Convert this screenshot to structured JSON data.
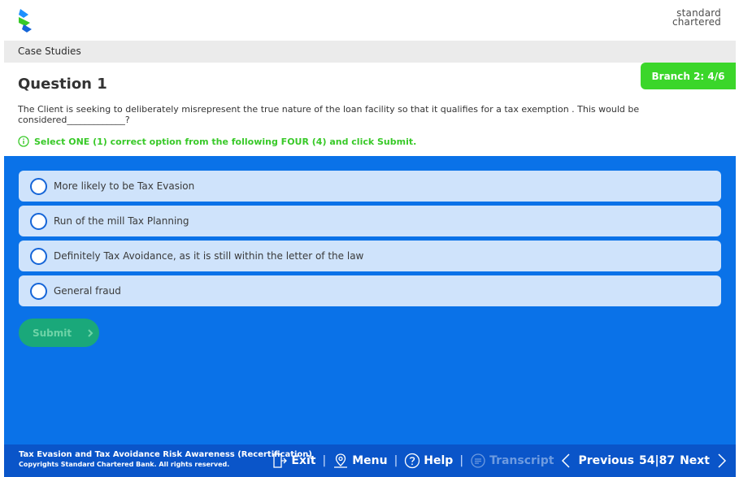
{
  "header": {
    "brand_line1": "standard",
    "brand_line2": "chartered"
  },
  "breadcrumb": "Case Studies",
  "branch_badge": "Branch 2: 4/6",
  "question": {
    "title": "Question 1",
    "text": "The Client is seeking to deliberately misrepresent the true nature of the loan facility so that it qualifies for a tax exemption . This would be considered_____________?",
    "instruction": "Select ONE (1) correct option from the following FOUR (4) and click Submit."
  },
  "options": [
    {
      "label": "More likely to be Tax Evasion",
      "selected": false
    },
    {
      "label": "Run of the mill Tax Planning",
      "selected": false
    },
    {
      "label": "Definitely Tax Avoidance, as it is still within the letter of the law",
      "selected": false
    },
    {
      "label": "General fraud",
      "selected": false
    }
  ],
  "submit_label": "Submit",
  "footer": {
    "course_title": "Tax Evasion and Tax Avoidance Risk Awareness (Recertification)",
    "copyright": "Copyrights Standard Chartered Bank. All rights reserved.",
    "exit_label": "Exit",
    "menu_label": "Menu",
    "help_label": "Help",
    "transcript_label": "Transcript",
    "previous_label": "Previous",
    "page_current": "54",
    "page_total": "87",
    "next_label": "Next"
  },
  "colors": {
    "panel_blue": "#0a72e8",
    "footer_blue": "#0a55c9",
    "accent_green": "#3bd62a",
    "submit_disabled": "#1aa87a"
  }
}
